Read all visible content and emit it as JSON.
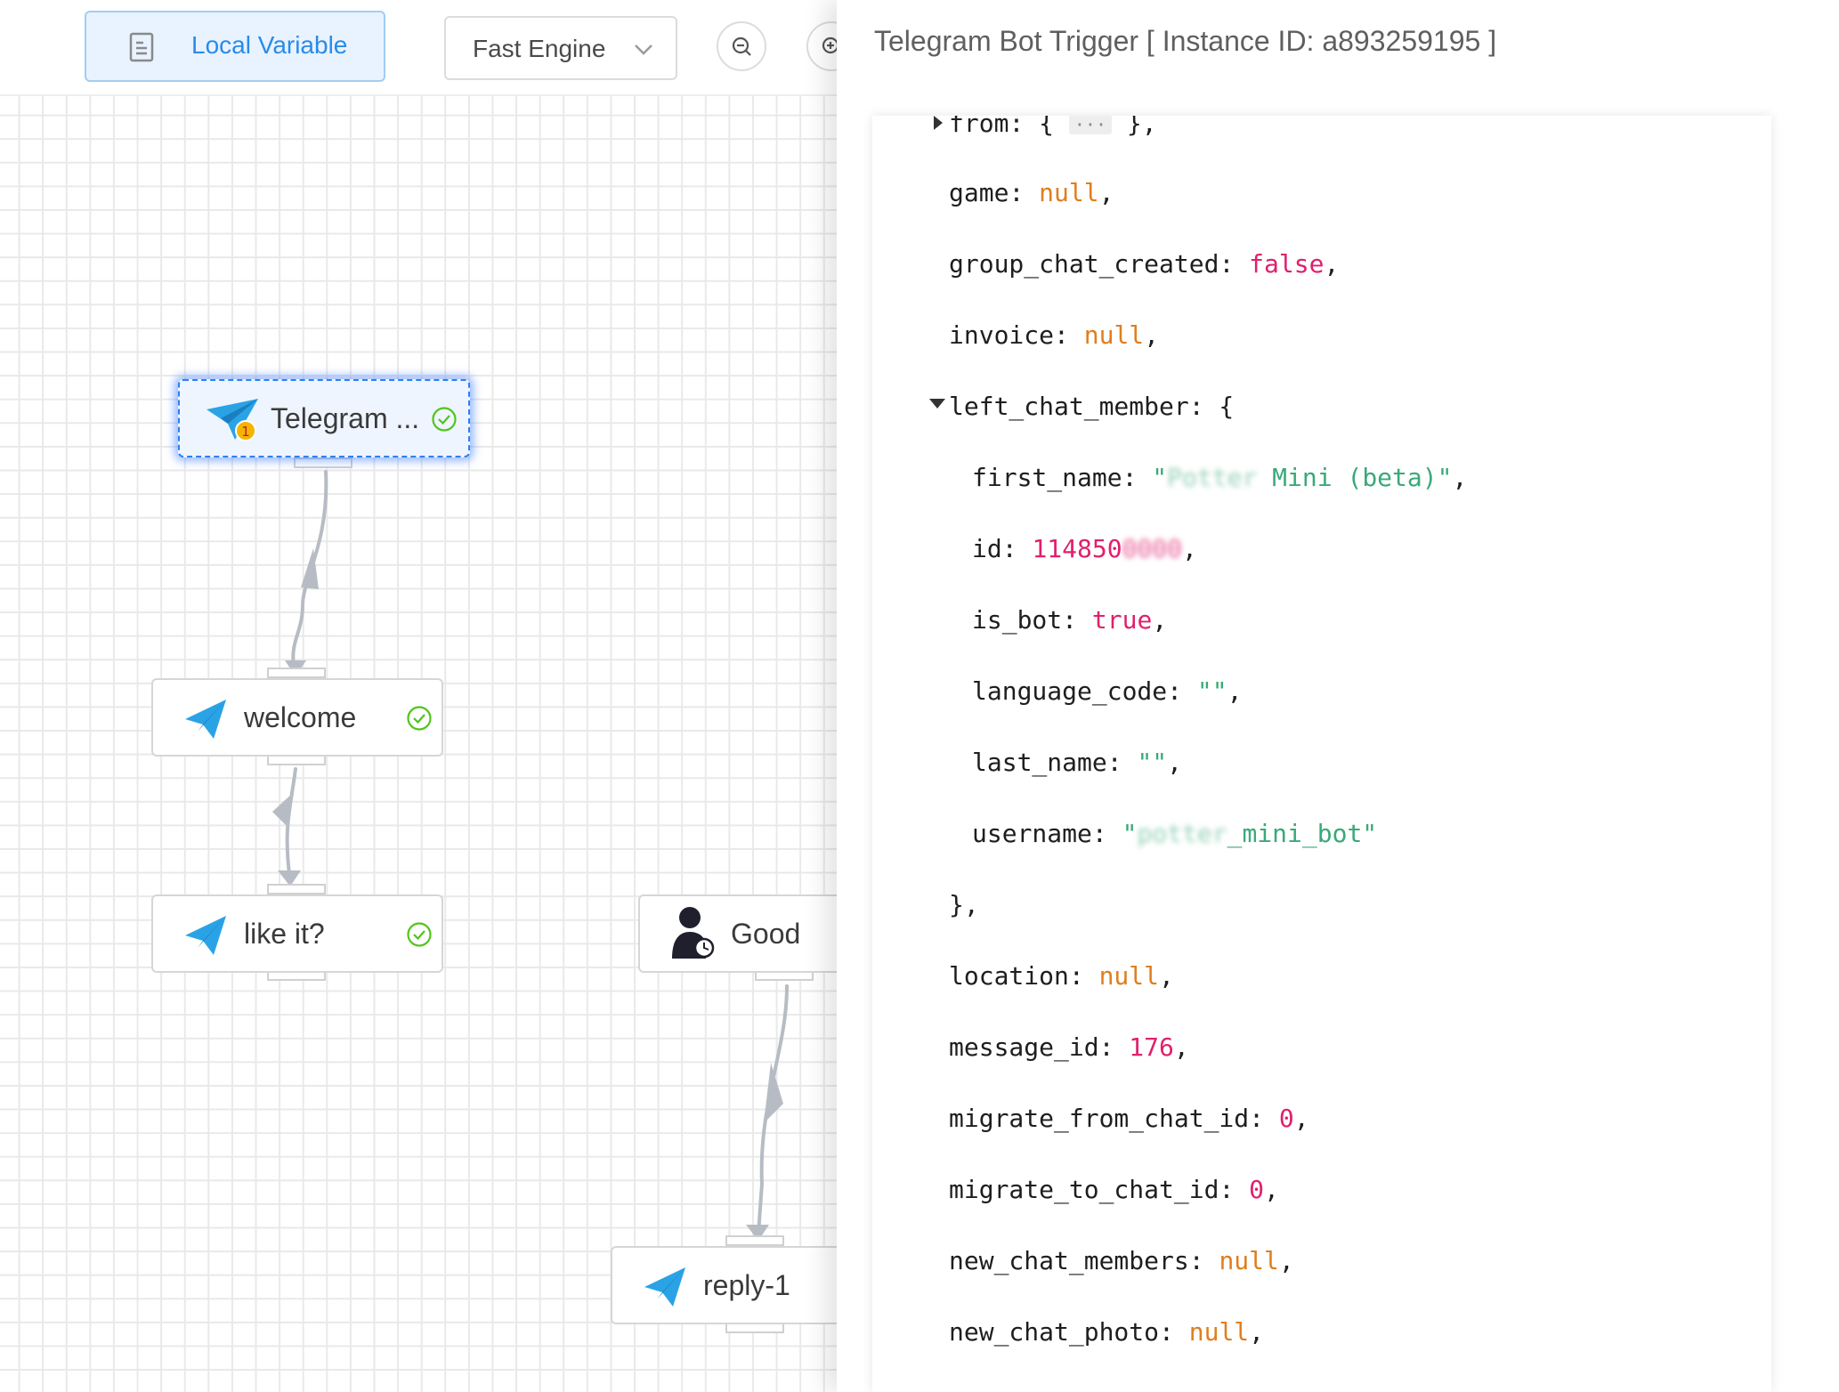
{
  "toolbar": {
    "local_variable_label": "Local Variable",
    "engine_value": "Fast Engine",
    "doc_icon": "document-icon",
    "zoom_out_icon": "zoom-out-icon",
    "zoom_in_icon": "zoom-in-icon"
  },
  "nodes": [
    {
      "label": "Telegram ...",
      "icon": "telegram-trigger-icon",
      "status": "check-circle-icon",
      "selected": true
    },
    {
      "label": "welcome",
      "icon": "telegram-icon",
      "status": "check-circle-icon"
    },
    {
      "label": "like it?",
      "icon": "telegram-icon",
      "status": "check-circle-icon"
    },
    {
      "label": "Good",
      "icon": "user-clock-icon"
    },
    {
      "label": "reply-1",
      "icon": "telegram-icon"
    }
  ],
  "panel": {
    "title": "Telegram Bot Trigger [ Instance ID: a893259195 ]",
    "json_lines": {
      "from_key": "from",
      "from_open": "{",
      "from_pill": "···",
      "from_close": "},",
      "game_key": "game",
      "game_val": "null",
      "group_chat_created_key": "group_chat_created",
      "group_chat_created_val": "false",
      "invoice_key": "invoice",
      "invoice_val": "null",
      "left_chat_member_key": "left_chat_member",
      "first_name_key": "first_name",
      "first_name_val_visible": "Mini (beta)\"",
      "id_key": "id",
      "id_val_visible": "114850",
      "is_bot_key": "is_bot",
      "is_bot_val": "true",
      "language_code_key": "language_code",
      "language_code_val": "\"\"",
      "last_name_key": "last_name",
      "last_name_val": "\"\"",
      "username_key": "username",
      "username_val_visible": "_mini_bot\"",
      "close_brace": "},",
      "location_key": "location",
      "location_val": "null",
      "message_id_key": "message_id",
      "message_id_val": "176",
      "migrate_from_chat_id_key": "migrate_from_chat_id",
      "migrate_from_chat_id_val": "0",
      "migrate_to_chat_id_key": "migrate_to_chat_id",
      "migrate_to_chat_id_val": "0",
      "new_chat_members_key": "new_chat_members",
      "new_chat_members_val": "null",
      "new_chat_photo_key": "new_chat_photo",
      "new_chat_photo_val": "null"
    }
  },
  "colors": {
    "accent": "#2a8be8",
    "null": "#e07e1e",
    "bool_num": "#e0206e",
    "string": "#3aa979",
    "success": "#52c41a",
    "telegram": "#2aa3e6"
  }
}
